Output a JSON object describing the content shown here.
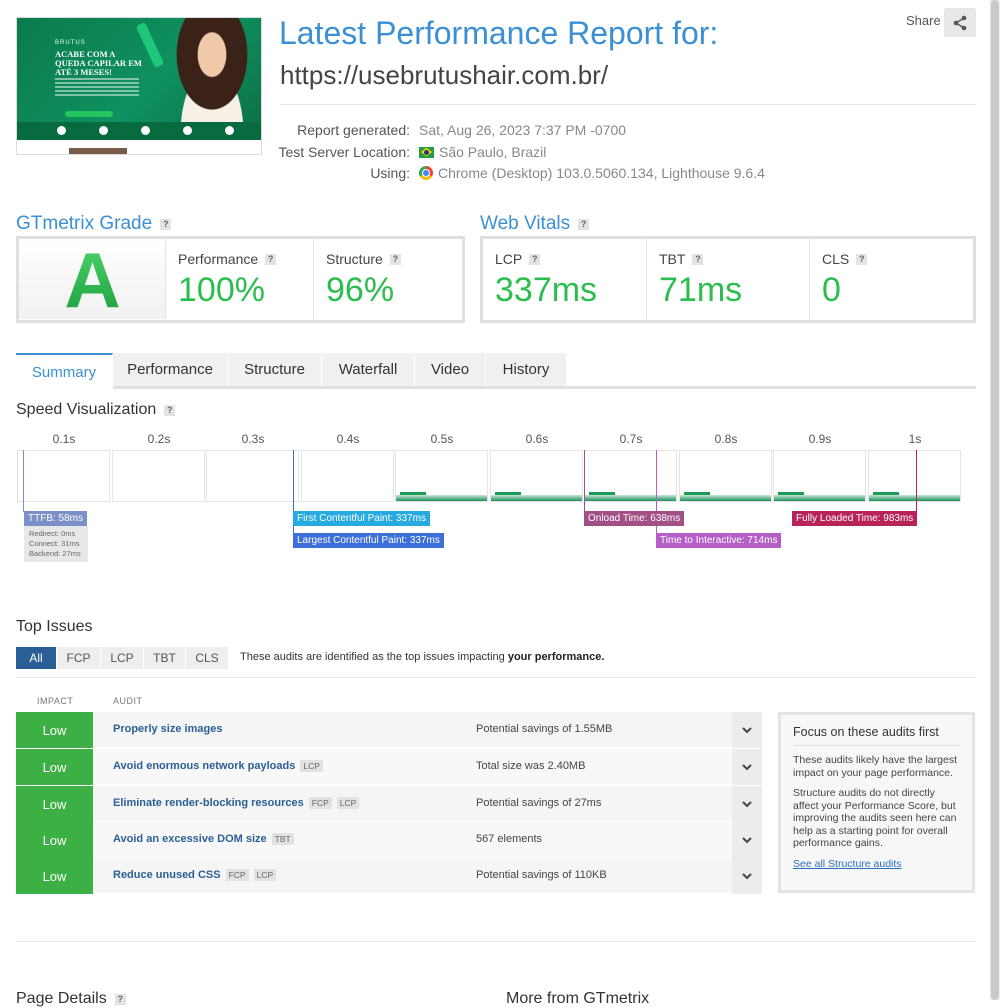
{
  "header": {
    "title_line1": "Latest Performance Report for:",
    "url": "https://usebrutushair.com.br/",
    "share_label": "Share",
    "thumbnail_headline": "ACABE COM A QUEDA CAPILAR EM ATÉ 3 MESES!",
    "report_generated_label": "Report generated:",
    "report_generated_value": "Sat, Aug 26, 2023 7:37 PM -0700",
    "location_label": "Test Server Location:",
    "location_value": "São Paulo, Brazil",
    "using_label": "Using:",
    "using_value": "Chrome (Desktop) 103.0.5060.134, Lighthouse 9.6.4"
  },
  "grade": {
    "title": "GTmetrix Grade",
    "letter": "A",
    "performance_label": "Performance",
    "performance_value": "100%",
    "structure_label": "Structure",
    "structure_value": "96%"
  },
  "vitals": {
    "title": "Web Vitals",
    "lcp_label": "LCP",
    "lcp_value": "337ms",
    "tbt_label": "TBT",
    "tbt_value": "71ms",
    "cls_label": "CLS",
    "cls_value": "0"
  },
  "tabs": [
    "Summary",
    "Performance",
    "Structure",
    "Waterfall",
    "Video",
    "History"
  ],
  "speed": {
    "title": "Speed Visualization",
    "ticks": [
      "0.1s",
      "0.2s",
      "0.3s",
      "0.4s",
      "0.5s",
      "0.6s",
      "0.7s",
      "0.8s",
      "0.9s",
      "1s"
    ],
    "ttfb": "TTFB: 58ms",
    "redirect": "Redirect: 0ms",
    "connect": "Connect: 31ms",
    "backend": "Backend: 27ms",
    "fcp": "First Contentful Paint: 337ms",
    "lcp": "Largest Contentful Paint: 337ms",
    "onload": "Onload Time: 638ms",
    "tti": "Time to Interactive: 714ms",
    "fully_loaded": "Fully Loaded Time: 983ms",
    "colors": {
      "ttfb": "#7b8fc8",
      "fcp": "#27a9e1",
      "lcp": "#3c6fd8",
      "onload": "#a24f86",
      "tti": "#b45ec8",
      "fully_loaded": "#b8245a"
    }
  },
  "issues": {
    "title": "Top Issues",
    "filters": [
      "All",
      "FCP",
      "LCP",
      "TBT",
      "CLS"
    ],
    "note_prefix": "These audits are identified as the top issues impacting",
    "note_bold": "your performance.",
    "col_impact": "IMPACT",
    "col_audit": "AUDIT",
    "rows": [
      {
        "impact": "Low",
        "audit": "Properly size images",
        "tags": [],
        "detail": "Potential savings of 1.55MB"
      },
      {
        "impact": "Low",
        "audit": "Avoid enormous network payloads",
        "tags": [
          "LCP"
        ],
        "detail": "Total size was 2.40MB"
      },
      {
        "impact": "Low",
        "audit": "Eliminate render-blocking resources",
        "tags": [
          "FCP",
          "LCP"
        ],
        "detail": "Potential savings of 27ms"
      },
      {
        "impact": "Low",
        "audit": "Avoid an excessive DOM size",
        "tags": [
          "TBT"
        ],
        "detail": "567 elements"
      },
      {
        "impact": "Low",
        "audit": "Reduce unused CSS",
        "tags": [
          "FCP",
          "LCP"
        ],
        "detail": "Potential savings of 110KB"
      }
    ],
    "focus": {
      "title": "Focus on these audits first",
      "p1": "These audits likely have the largest impact on your page performance.",
      "p2": "Structure audits do not directly affect your Performance Score, but improving the audits seen here can help as a starting point for overall performance gains.",
      "link": "See all Structure audits"
    }
  },
  "footer": {
    "page_details": "Page Details",
    "more_from": "More from GTmetrix"
  },
  "colors": {
    "accent": "#3b8fd4",
    "grade_green": "#2bbd4e",
    "impact_low": "#3db045",
    "filter_active": "#2a5f95"
  }
}
